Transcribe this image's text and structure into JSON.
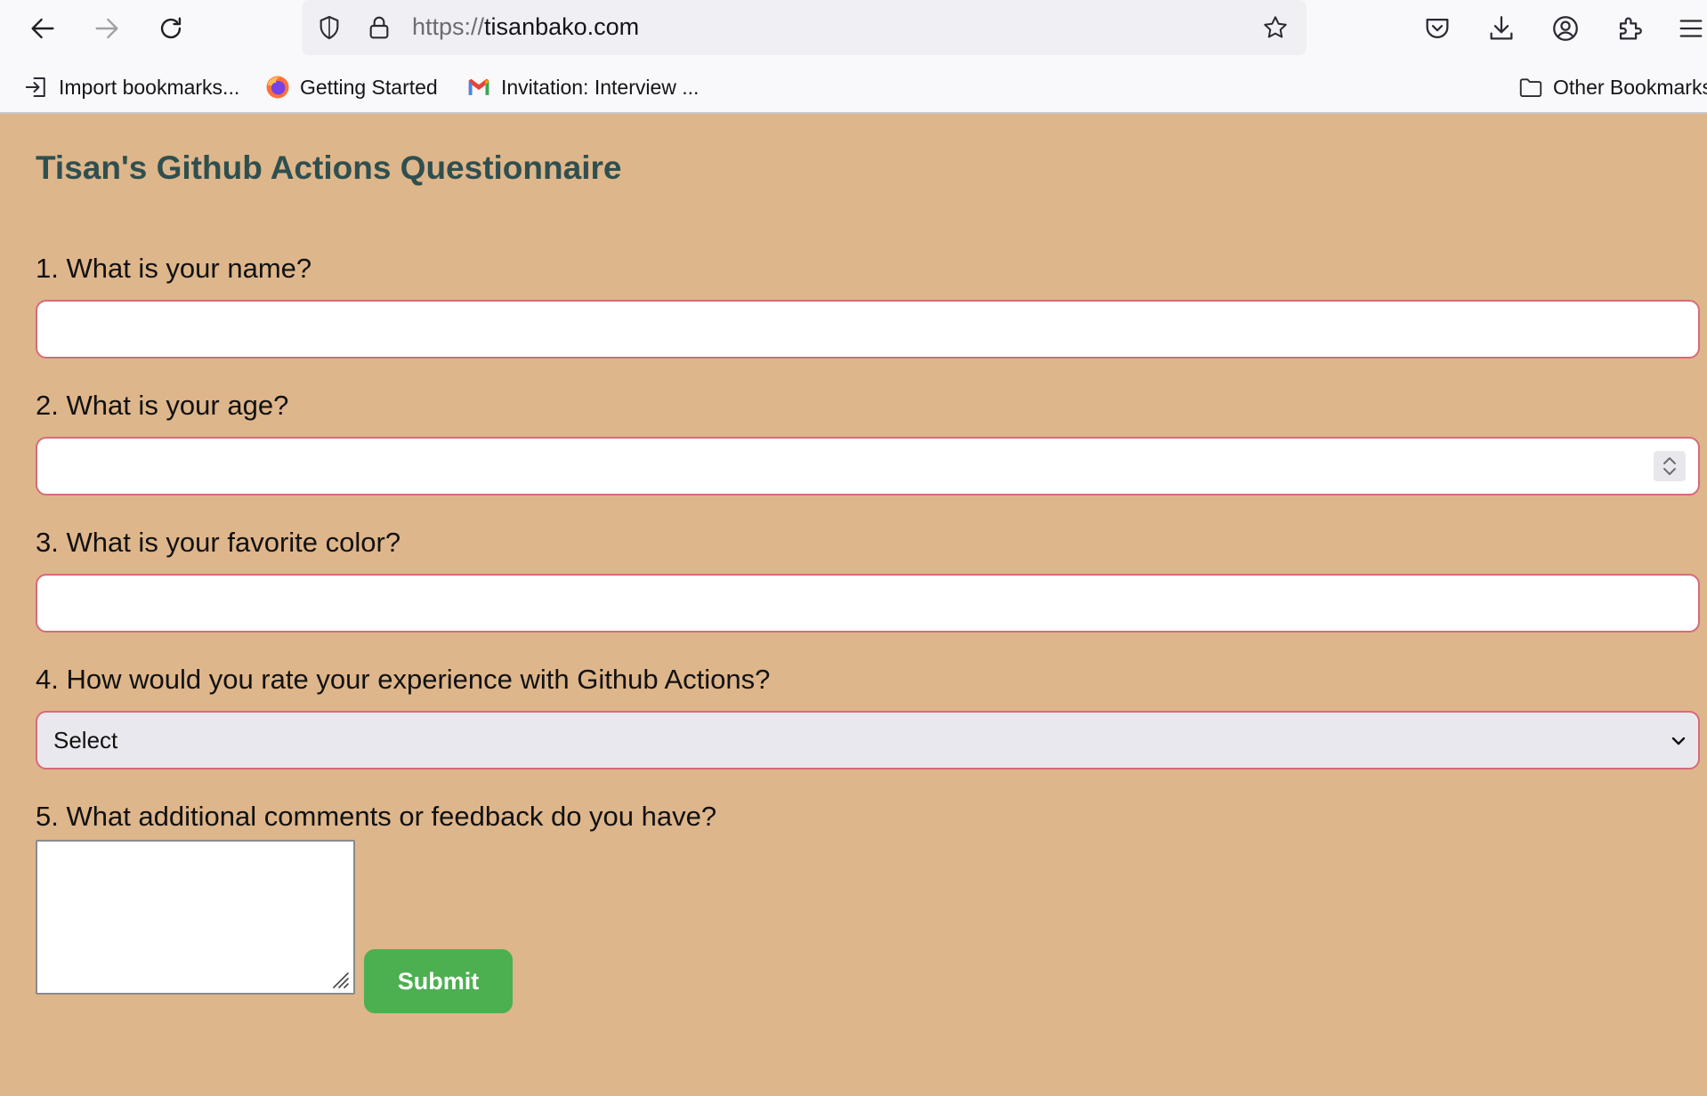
{
  "browser": {
    "url_scheme": "https://",
    "url_host": "tisanbako.com",
    "bookmarks": [
      {
        "label": "Import bookmarks...",
        "icon": "import-icon"
      },
      {
        "label": "Getting Started",
        "icon": "firefox-icon"
      },
      {
        "label": "Invitation: Interview ...",
        "icon": "gmail-icon"
      }
    ],
    "other_bookmarks": "Other Bookmarks"
  },
  "form": {
    "title": "Tisan's Github Actions Questionnaire",
    "questions": [
      {
        "label": "1. What is your name?",
        "value": ""
      },
      {
        "label": "2. What is your age?",
        "value": ""
      },
      {
        "label": "3. What is your favorite color?",
        "value": ""
      },
      {
        "label": "4. How would you rate your experience with Github Actions?",
        "selected": "Select"
      },
      {
        "label": "5. What additional comments or feedback do you have?",
        "value": ""
      }
    ],
    "submit_label": "Submit"
  },
  "colors": {
    "page_background": "#deb68b",
    "title": "#2f4f4f",
    "field_border": "#d66a7a",
    "submit_background": "#4caf50"
  }
}
